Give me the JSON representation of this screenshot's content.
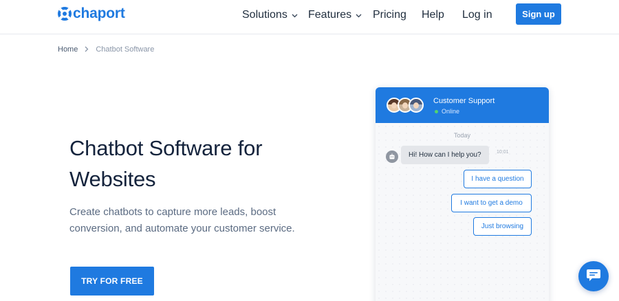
{
  "header": {
    "logo_text": "chaport",
    "nav": [
      {
        "label": "Solutions",
        "has_dropdown": true
      },
      {
        "label": "Features",
        "has_dropdown": true
      },
      {
        "label": "Pricing",
        "has_dropdown": false
      },
      {
        "label": "Help",
        "has_dropdown": false
      },
      {
        "label": "Log in",
        "has_dropdown": false
      }
    ],
    "signup_label": "Sign up"
  },
  "breadcrumb": {
    "home": "Home",
    "separator_icon": "chevron-right-icon",
    "current": "Chatbot Software"
  },
  "hero": {
    "title": "Chatbot Software for Websites",
    "description": "Create chatbots to capture more leads, boost conversion, and automate your customer service.",
    "cta_label": "TRY FOR FREE"
  },
  "chat_widget": {
    "title": "Customer Support",
    "status": "Online",
    "day_label": "Today",
    "bot_message": "Hi! How can I help you?",
    "message_time": "10:01",
    "quick_replies": [
      "I have a question",
      "I want to get a demo",
      "Just browsing"
    ]
  },
  "launcher": {
    "icon": "chat-bubble-icon"
  },
  "colors": {
    "brand": "#1f7ae0",
    "title": "#14233c",
    "body_text": "#5b6b82",
    "online": "#52d36f"
  }
}
